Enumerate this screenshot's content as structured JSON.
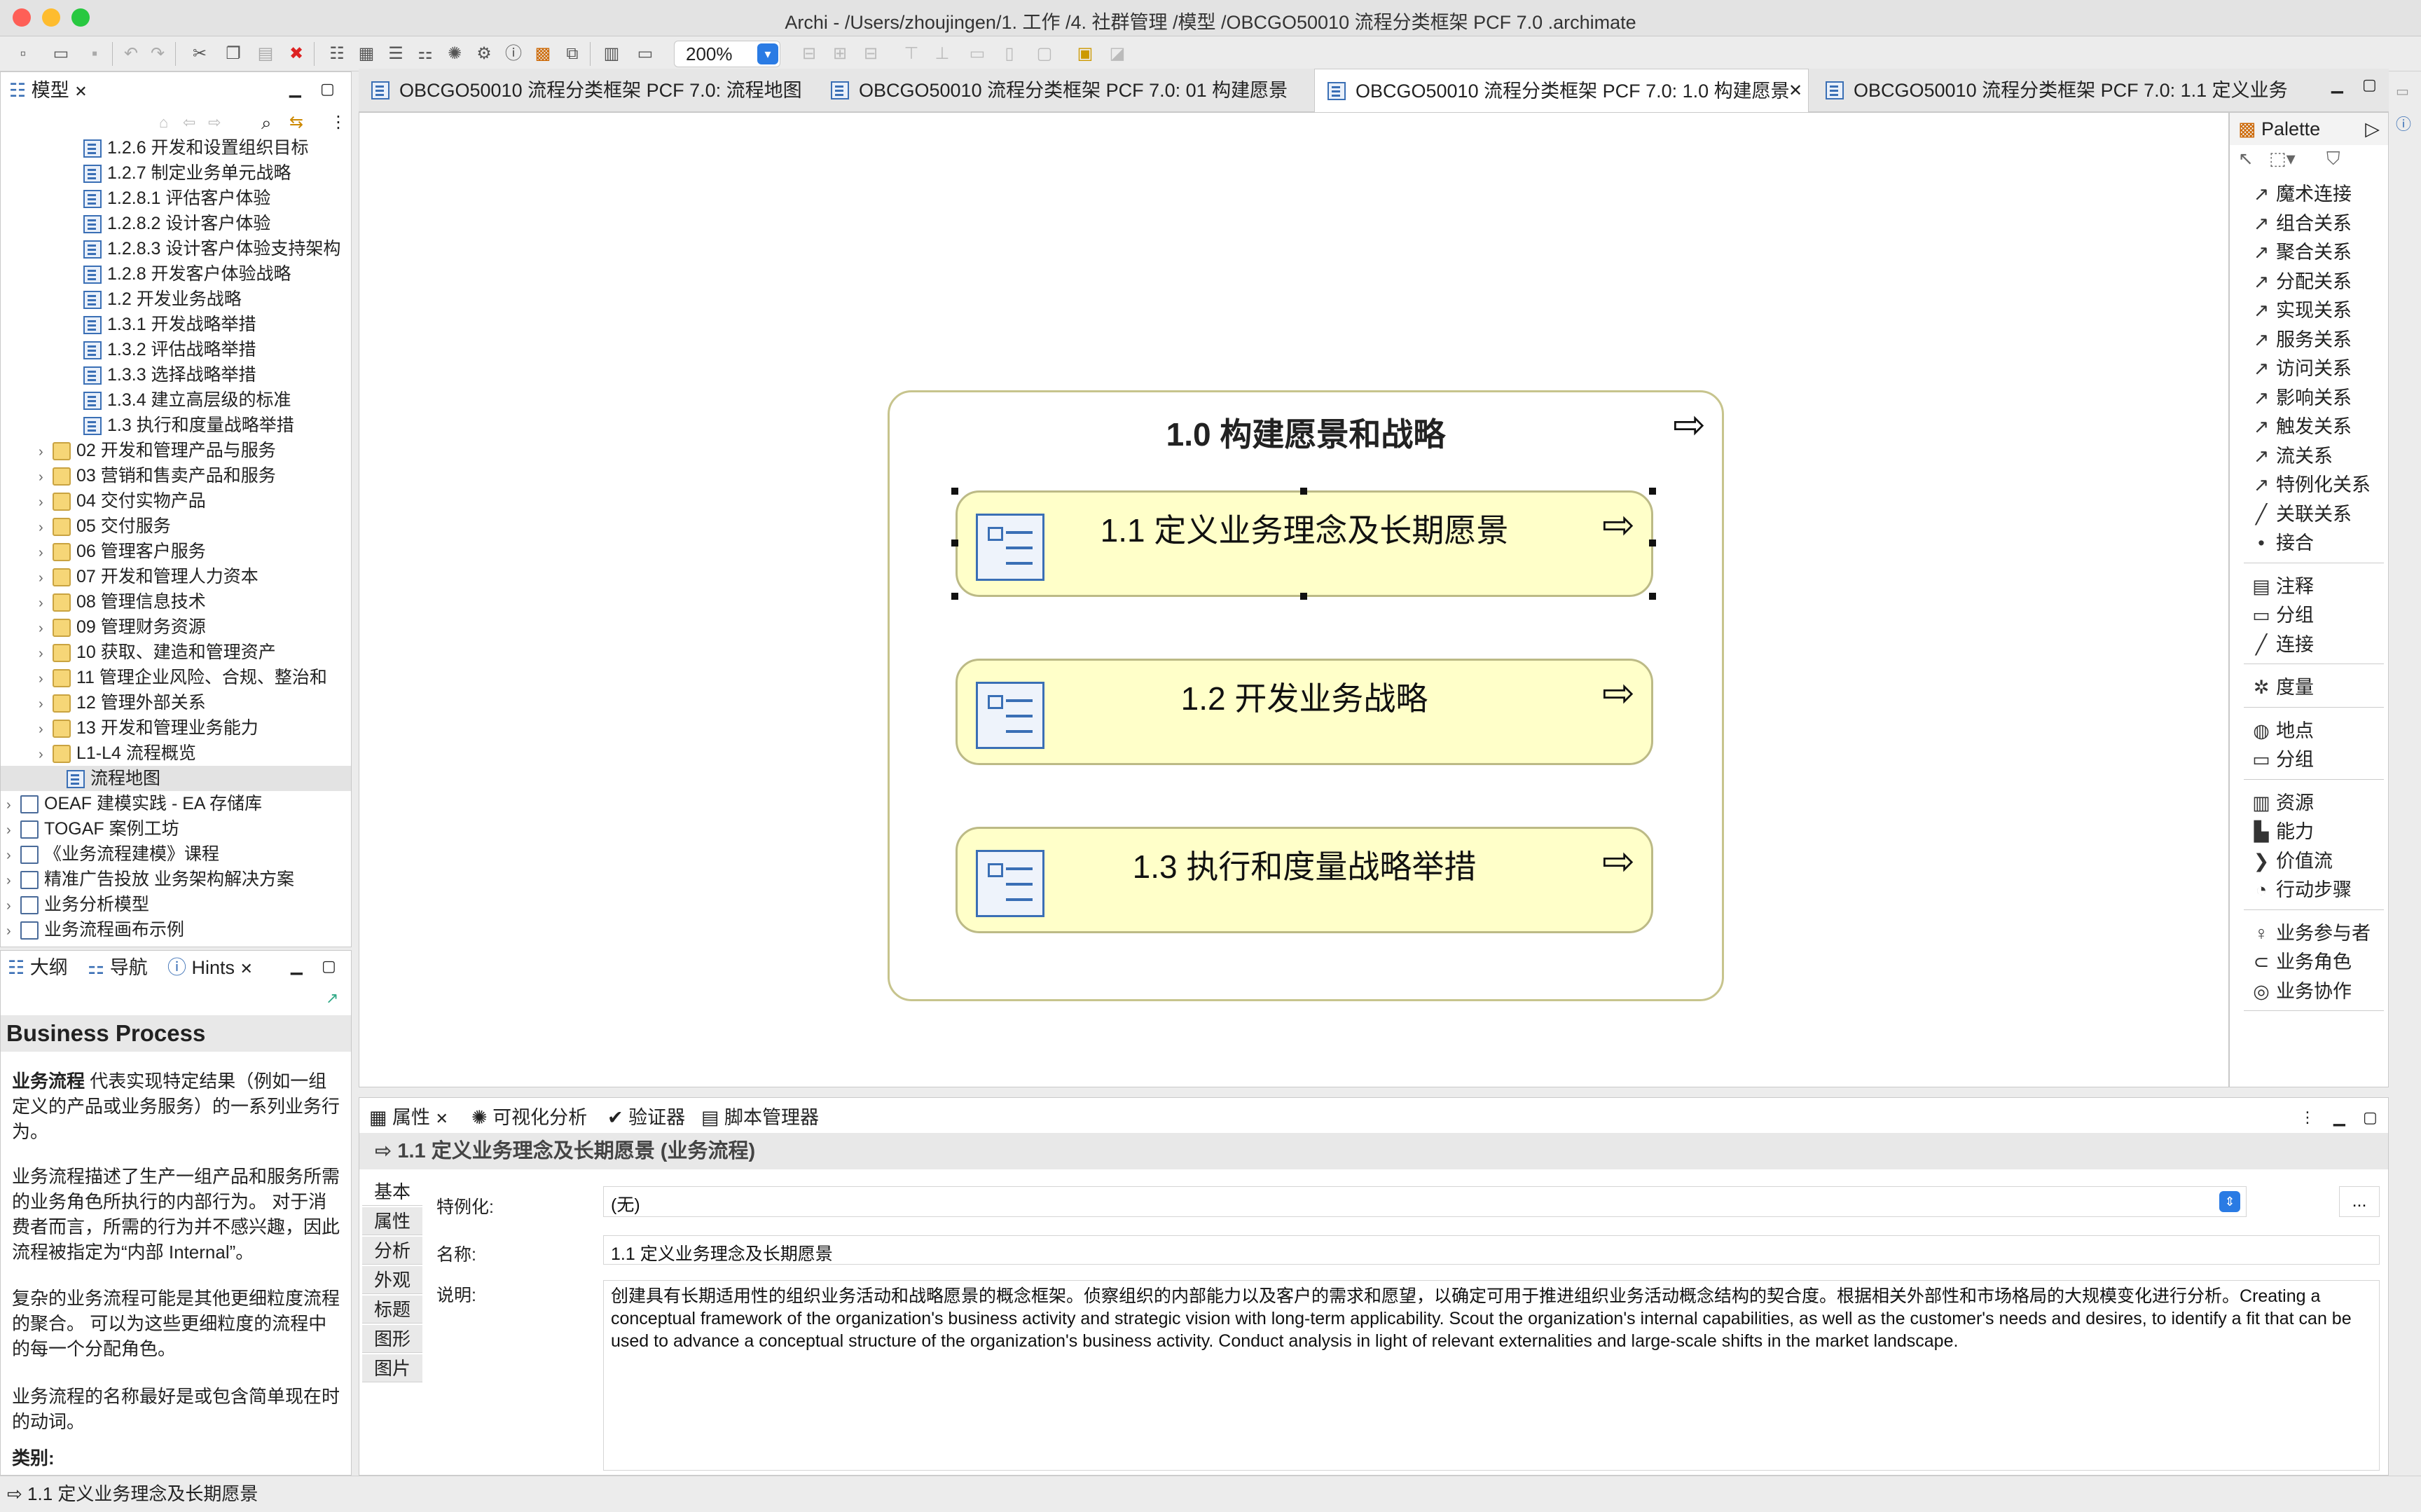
{
  "window": {
    "title": "Archi - /Users/zhoujingen/1. 工作 /4. 社群管理 /模型 /OBCGO50010 流程分类框架 PCF 7.0 .archimate"
  },
  "toolbar": {
    "zoom": "200%"
  },
  "model_panel": {
    "tab": "模型",
    "tree": [
      {
        "label": "1.2.6 开发和设置组织目标",
        "type": "diagram"
      },
      {
        "label": "1.2.7 制定业务单元战略",
        "type": "diagram"
      },
      {
        "label": "1.2.8.1 评估客户体验",
        "type": "diagram"
      },
      {
        "label": "1.2.8.2 设计客户体验",
        "type": "diagram"
      },
      {
        "label": "1.2.8.3 设计客户体验支持架构",
        "type": "diagram"
      },
      {
        "label": "1.2.8 开发客户体验战略",
        "type": "diagram"
      },
      {
        "label": "1.2 开发业务战略",
        "type": "diagram"
      },
      {
        "label": "1.3.1 开发战略举措",
        "type": "diagram"
      },
      {
        "label": "1.3.2 评估战略举措",
        "type": "diagram"
      },
      {
        "label": "1.3.3 选择战略举措",
        "type": "diagram"
      },
      {
        "label": "1.3.4 建立高层级的标准",
        "type": "diagram"
      },
      {
        "label": "1.3 执行和度量战略举措",
        "type": "diagram"
      },
      {
        "label": "02 开发和管理产品与服务",
        "type": "folder"
      },
      {
        "label": "03 营销和售卖产品和服务",
        "type": "folder"
      },
      {
        "label": "04 交付实物产品",
        "type": "folder"
      },
      {
        "label": "05 交付服务",
        "type": "folder"
      },
      {
        "label": "06 管理客户服务",
        "type": "folder"
      },
      {
        "label": "07 开发和管理人力资本",
        "type": "folder"
      },
      {
        "label": "08 管理信息技术",
        "type": "folder"
      },
      {
        "label": "09 管理财务资源",
        "type": "folder"
      },
      {
        "label": "10 获取、建造和管理资产",
        "type": "folder"
      },
      {
        "label": "11 管理企业风险、合规、整治和",
        "type": "folder"
      },
      {
        "label": "12 管理外部关系",
        "type": "folder"
      },
      {
        "label": "13 开发和管理业务能力",
        "type": "folder"
      },
      {
        "label": "L1-L4 流程概览",
        "type": "folder"
      },
      {
        "label": "流程地图",
        "type": "diagram-selected"
      },
      {
        "label": "OEAF 建模实践 - EA 存储库",
        "type": "model"
      },
      {
        "label": "TOGAF 案例工坊",
        "type": "model"
      },
      {
        "label": "《业务流程建模》课程",
        "type": "model"
      },
      {
        "label": "精准广告投放 业务架构解决方案",
        "type": "model"
      },
      {
        "label": "业务分析模型",
        "type": "model"
      },
      {
        "label": "业务流程画布示例",
        "type": "model"
      }
    ]
  },
  "lower_left_tabs": [
    "大纲",
    "导航",
    "Hints"
  ],
  "hints": {
    "title": "Business Process",
    "p1_bold": "业务流程",
    "p1": " 代表实现特定结果（例如一组定义的产品或业务服务）的一系列业务行为。",
    "p2": "业务流程描述了生产一组产品和服务所需的业务角色所执行的内部行为。 对于消费者而言，所需的行为并不感兴趣，因此流程被指定为“内部 Internal”。",
    "p3": "复杂的业务流程可能是其他更细粒度流程的聚合。 可以为这些更细粒度的流程中的每一个分配角色。",
    "p4": "业务流程的名称最好是或包含简单现在时的动词。",
    "p5": "类别:"
  },
  "editor_tabs": [
    "OBCGO50010 流程分类框架 PCF 7.0: 流程地图",
    "OBCGO50010 流程分类框架 PCF 7.0: 01 构建愿景",
    "OBCGO50010 流程分类框架 PCF 7.0: 1.0 构建愿景",
    "OBCGO50010 流程分类框架 PCF 7.0: 1.1 定义业务"
  ],
  "diagram": {
    "outer": "1.0 构建愿景和战略",
    "processes": [
      "1.1 定义业务理念及长期愿景",
      "1.2 开发业务战略",
      "1.3 执行和度量战略举措"
    ]
  },
  "palette": {
    "title": "Palette",
    "groups": [
      [
        {
          "icon": "↗",
          "label": "魔术连接"
        },
        {
          "icon": "↗",
          "label": "组合关系"
        },
        {
          "icon": "↗",
          "label": "聚合关系"
        },
        {
          "icon": "↗",
          "label": "分配关系"
        },
        {
          "icon": "↗",
          "label": "实现关系"
        },
        {
          "icon": "↗",
          "label": "服务关系"
        },
        {
          "icon": "↗",
          "label": "访问关系"
        },
        {
          "icon": "↗",
          "label": "影响关系"
        },
        {
          "icon": "↗",
          "label": "触发关系"
        },
        {
          "icon": "↗",
          "label": "流关系"
        },
        {
          "icon": "↗",
          "label": "特例化关系"
        },
        {
          "icon": "╱",
          "label": "关联关系"
        },
        {
          "icon": "•",
          "label": "接合"
        }
      ],
      [
        {
          "icon": "▤",
          "label": "注释"
        },
        {
          "icon": "▭",
          "label": "分组"
        },
        {
          "icon": "╱",
          "label": "连接"
        }
      ],
      [
        {
          "icon": "✲",
          "label": "度量"
        }
      ],
      [
        {
          "icon": "◍",
          "label": "地点"
        },
        {
          "icon": "▭",
          "label": "分组"
        }
      ],
      [
        {
          "icon": "▥",
          "label": "资源"
        },
        {
          "icon": "▙",
          "label": "能力"
        },
        {
          "icon": "❯",
          "label": "价值流"
        },
        {
          "icon": "◔",
          "label": "行动步骤"
        }
      ],
      [
        {
          "icon": "♀",
          "label": "业务参与者"
        },
        {
          "icon": "⊂",
          "label": "业务角色"
        },
        {
          "icon": "◎",
          "label": "业务协作"
        }
      ]
    ]
  },
  "props": {
    "tabs": [
      "属性",
      "可视化分析",
      "验证器",
      "脚本管理器"
    ],
    "header": "1.1 定义业务理念及长期愿景 (业务流程)",
    "vtabs": [
      "基本",
      "属性",
      "分析",
      "外观",
      "标题",
      "图形",
      "图片"
    ],
    "spec_label": "特例化:",
    "spec_value": "(无)",
    "name_label": "名称:",
    "name_value": "1.1 定义业务理念及长期愿景",
    "desc_label": "说明:",
    "desc_value": "创建具有长期适用性的组织业务活动和战略愿景的概念框架。侦察组织的内部能力以及客户的需求和愿望，以确定可用于推进组织业务活动概念结构的契合度。根据相关外部性和市场格局的大规模变化进行分析。Creating a conceptual framework of the organization's business activity and strategic vision with long-term applicability. Scout the organization's internal capabilities, as well as the customer's needs and desires, to identify a fit that can be used to advance a conceptual structure of the organization's business activity. Conduct analysis in light of relevant externalities and large-scale shifts in the market landscape.",
    "more_btn": "..."
  },
  "status": {
    "text": "1.1 定义业务理念及长期愿景"
  }
}
